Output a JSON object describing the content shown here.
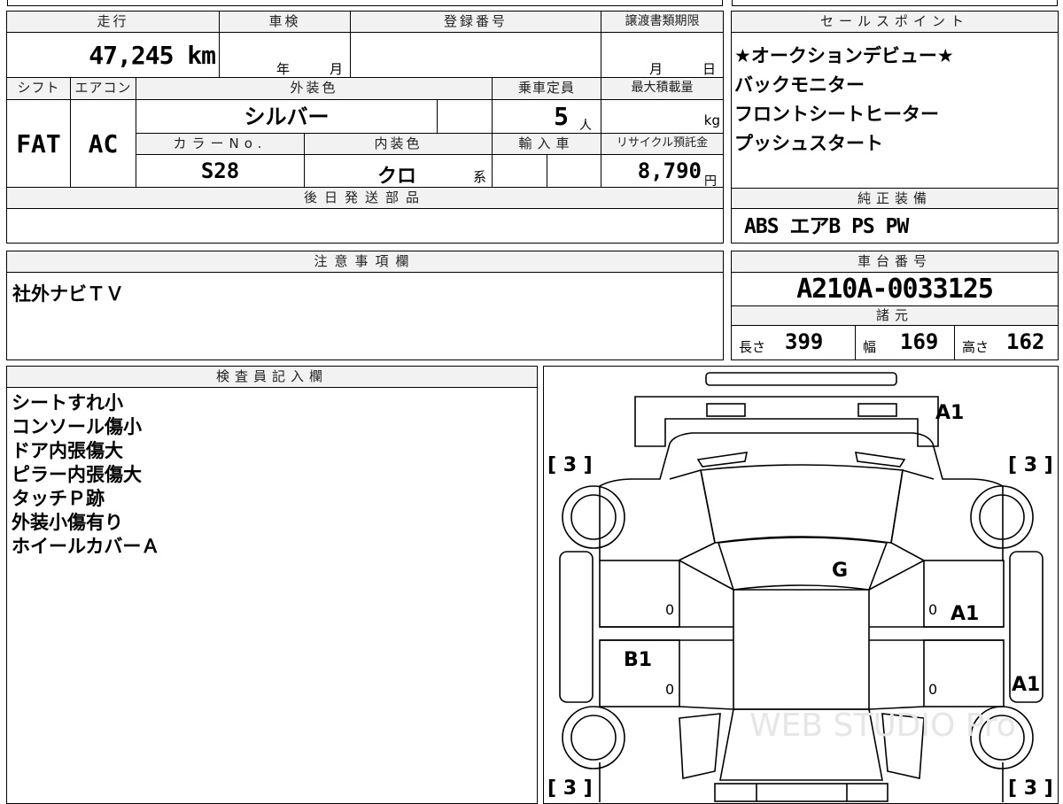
{
  "top_table": {
    "h_mileage": "走行",
    "h_inspection": "車検",
    "h_reg_no": "登録番号",
    "h_deadline": "譲渡書類期限",
    "mileage": "47,245 km",
    "insp_year": "年",
    "insp_month": "月",
    "deadline_month": "月",
    "deadline_day": "日",
    "h_shift": "シフト",
    "h_ac": "エアコン",
    "h_ext_color": "外装色",
    "h_capacity": "乗車定員",
    "h_max_load": "最大積載量",
    "shift": "FAT",
    "ac": "AC",
    "ext_color": "シルバー",
    "capacity": "5",
    "capacity_unit": "人",
    "load_unit": "kg",
    "h_color_no": "カラーNo.",
    "h_int_color": "内装色",
    "h_import": "輸入車",
    "h_recycle": "リサイクル預託金",
    "color_no": "S28",
    "int_color": "クロ",
    "int_suffix": "系",
    "recycle": "8,790",
    "recycle_unit": "円",
    "h_later_parts": "後日発送部品"
  },
  "sales_points": {
    "header": "セールスポイント",
    "items": [
      "★オークションデビュー★",
      "バックモニター",
      "フロントシートヒーター",
      "プッシュスタート"
    ]
  },
  "standard_equip": {
    "header": "純正装備",
    "value": "ABS エアB PS PW"
  },
  "notes": {
    "header": "注意事項欄",
    "text": "社外ナビＴＶ"
  },
  "chassis": {
    "header": "車台番号",
    "number": "A210A-0033125",
    "specs_header": "諸元",
    "length_label": "長さ",
    "length": "399",
    "width_label": "幅",
    "width": "169",
    "height_label": "高さ",
    "height": "162"
  },
  "inspector": {
    "header": "検査員記入欄",
    "lines": [
      "シートすれ小",
      "コンソール傷小",
      "ドア内張傷大",
      "ピラー内張傷大",
      "タッチＰ跡",
      "外装小傷有り",
      "ホイールカバーＡ"
    ]
  },
  "diagram": {
    "marks": {
      "front_bumper": "A1",
      "windshield": "G",
      "right_front_door": "A1",
      "left_rear_door": "B1",
      "right_rear_fender": "A1",
      "tire_fl": "[ 3 ]",
      "tire_fr": "[ 3 ]",
      "tire_rl": "[ 3 ]",
      "tire_rr": "[ 3 ]",
      "zero": "0"
    },
    "watermark": "WEB STUDIO Pro"
  }
}
